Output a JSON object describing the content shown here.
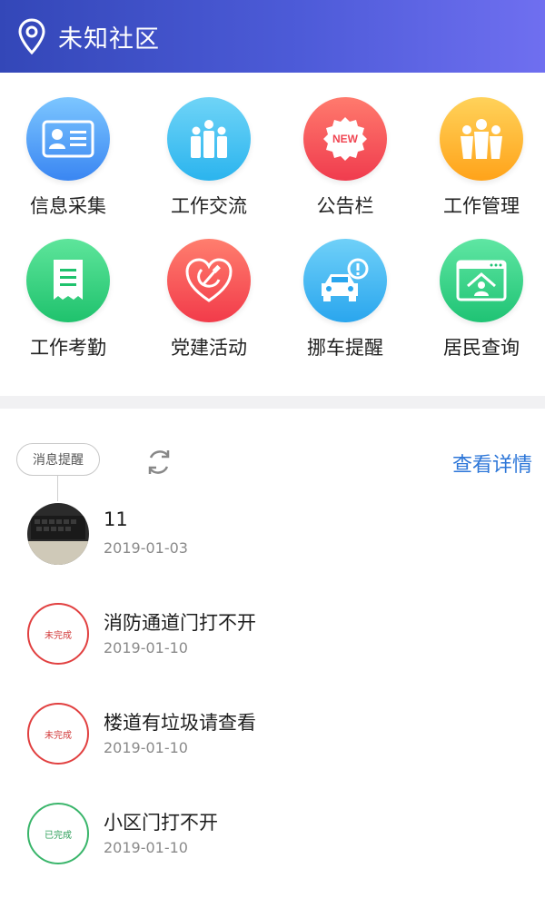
{
  "header": {
    "title": "未知社区",
    "pin_icon": "location-pin-icon"
  },
  "grid": [
    {
      "label": "信息采集",
      "icon": "id-card-icon",
      "color_from": "#7cc6ff",
      "color_to": "#3a86f2"
    },
    {
      "label": "工作交流",
      "icon": "people-group-icon",
      "color_from": "#6fd4f7",
      "color_to": "#2bb4ee"
    },
    {
      "label": "公告栏",
      "icon": "new-badge-icon",
      "color_from": "#ff7a6d",
      "color_to": "#f03c4e"
    },
    {
      "label": "工作管理",
      "icon": "team-icon",
      "color_from": "#ffd25a",
      "color_to": "#ffa31a"
    },
    {
      "label": "工作考勤",
      "icon": "receipt-icon",
      "color_from": "#5ee59b",
      "color_to": "#1fc26d"
    },
    {
      "label": "党建活动",
      "icon": "hammer-sickle-heart-icon",
      "color_from": "#ff7e6e",
      "color_to": "#f23b4a"
    },
    {
      "label": "挪车提醒",
      "icon": "car-alert-icon",
      "color_from": "#6fd0f8",
      "color_to": "#2aa6ee"
    },
    {
      "label": "居民查询",
      "icon": "resident-window-icon",
      "color_from": "#5fe6a3",
      "color_to": "#1fc374"
    }
  ],
  "messages_header": {
    "badge": "消息提醒",
    "view_details": "查看详情"
  },
  "messages": [
    {
      "title": "11",
      "date": "2019-01-03",
      "type": "photo"
    },
    {
      "title": "消防通道门打不开",
      "date": "2019-01-10",
      "type": "stamp",
      "stamp": "未完成",
      "stamp_color": "red"
    },
    {
      "title": "楼道有垃圾请查看",
      "date": "2019-01-10",
      "type": "stamp",
      "stamp": "未完成",
      "stamp_color": "red"
    },
    {
      "title": "小区门打不开",
      "date": "2019-01-10",
      "type": "stamp",
      "stamp": "已完成",
      "stamp_color": "green"
    }
  ]
}
